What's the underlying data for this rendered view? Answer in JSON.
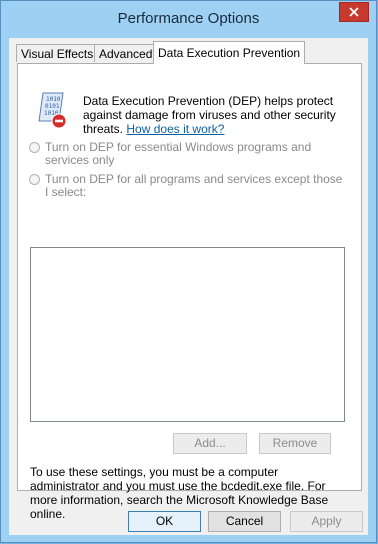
{
  "window": {
    "title": "Performance Options"
  },
  "tabs": [
    {
      "label": "Visual Effects"
    },
    {
      "label": "Advanced"
    },
    {
      "label": "Data Execution Prevention"
    }
  ],
  "dep": {
    "description": "Data Execution Prevention (DEP) helps protect against damage from viruses and other security threats.",
    "link": "How does it work?",
    "options": [
      {
        "label": "Turn on DEP for essential Windows programs and services only",
        "selected": false,
        "enabled": false
      },
      {
        "label": "Turn on DEP for all programs and services except those I select:",
        "selected": false,
        "enabled": false
      }
    ],
    "add_button": "Add...",
    "remove_button": "Remove",
    "info": "To use these settings, you must be a computer administrator and you must use the bcdedit.exe file. For more information, search the Microsoft Knowledge Base online."
  },
  "footer": {
    "ok": "OK",
    "cancel": "Cancel",
    "apply": "Apply"
  },
  "colors": {
    "close_button": "#c7392f",
    "link": "#0b5fa5",
    "titlebar": "#9ed0f3"
  }
}
